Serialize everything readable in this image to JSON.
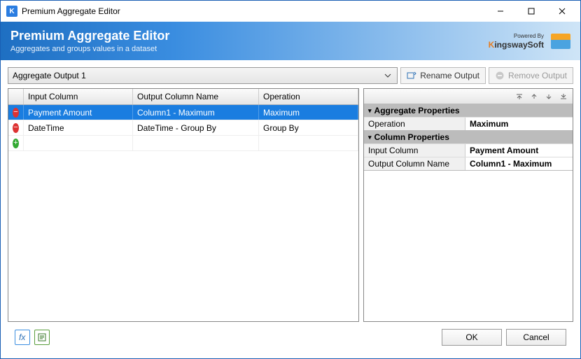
{
  "window": {
    "title": "Premium Aggregate Editor"
  },
  "header": {
    "title": "Premium Aggregate Editor",
    "subtitle": "Aggregates and groups values in a dataset",
    "powered_by": "Powered By",
    "brand_k": "K",
    "brand_rest": "ingswaySoft"
  },
  "output": {
    "selected": "Aggregate Output 1",
    "rename_label": "Rename Output",
    "remove_label": "Remove Output"
  },
  "grid": {
    "headers": {
      "input": "Input Column",
      "output": "Output Column Name",
      "operation": "Operation"
    },
    "rows": [
      {
        "input": "Payment Amount",
        "output": "Column1 - Maximum",
        "operation": "Maximum",
        "selected": true
      },
      {
        "input": "DateTime",
        "output": "DateTime - Group By",
        "operation": "Group By",
        "selected": false
      }
    ]
  },
  "props": {
    "agg_section": "Aggregate Properties",
    "col_section": "Column Properties",
    "operation_key": "Operation",
    "operation_val": "Maximum",
    "input_key": "Input Column",
    "input_val": "Payment Amount",
    "output_key": "Output Column Name",
    "output_val": "Column1 - Maximum"
  },
  "footer": {
    "ok": "OK",
    "cancel": "Cancel"
  }
}
